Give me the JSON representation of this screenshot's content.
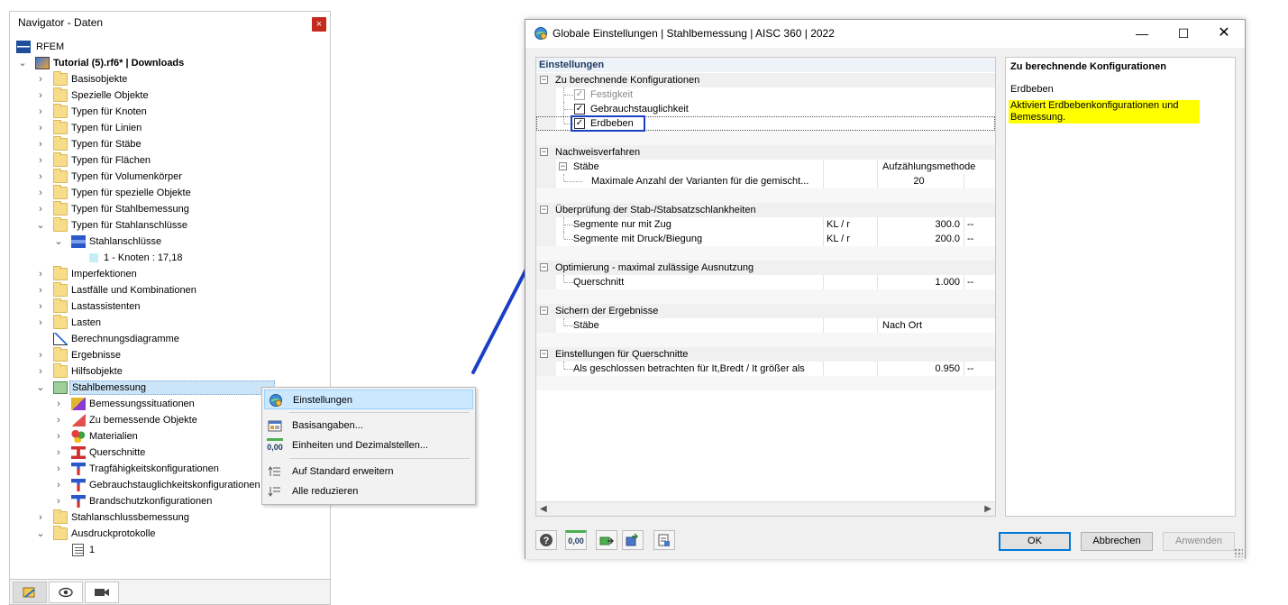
{
  "navigator": {
    "title": "Navigator - Daten",
    "close_glyph": "×",
    "root_label": "RFEM",
    "project_label": "Tutorial (5).rf6* | Downloads",
    "items": {
      "basisobjekte": "Basisobjekte",
      "spezielle_objekte": "Spezielle Objekte",
      "typen_knoten": "Typen für Knoten",
      "typen_linien": "Typen für Linien",
      "typen_staebe": "Typen für Stäbe",
      "typen_flaechen": "Typen für Flächen",
      "typen_volumen": "Typen für Volumenkörper",
      "typen_spezielle": "Typen für spezielle Objekte",
      "typen_stahlbemessung": "Typen für Stahlbemessung",
      "typen_stahlanschluesse": "Typen für Stahlanschlüsse",
      "stahlanschluesse": "Stahlanschlüsse",
      "knoten": "1 - Knoten : 17,18",
      "imperfektionen": "Imperfektionen",
      "lastfaelle": "Lastfälle und Kombinationen",
      "lastassistenten": "Lastassistenten",
      "lasten": "Lasten",
      "berechnungsdiagramme": "Berechnungsdiagramme",
      "ergebnisse": "Ergebnisse",
      "hilfsobjekte": "Hilfsobjekte",
      "stahlbemessung": "Stahlbemessung",
      "bemessungssituationen": "Bemessungssituationen",
      "zu_bemessende": "Zu bemessende Objekte",
      "materialien": "Materialien",
      "querschnitte": "Querschnitte",
      "tragfaehigkeit": "Tragfähigkeitskonfigurationen",
      "gebrauchstauglichkeit": "Gebrauchstauglichkeitskonfigurationen",
      "brandschutz": "Brandschutzkonfigurationen",
      "stahlanschlussbemessung": "Stahlanschlussbemessung",
      "ausdruckprotokolle": "Ausdruckprotokolle",
      "protokoll_1": "1"
    }
  },
  "context_menu": {
    "einstellungen": "Einstellungen",
    "basisangaben": "Basisangaben...",
    "einheiten": "Einheiten und Dezimalstellen...",
    "decimal_icon_text": "0,00",
    "erweitern": "Auf Standard erweitern",
    "reduzieren": "Alle reduzieren"
  },
  "dialog": {
    "title": "Globale Einstellungen | Stahlbemessung | AISC 360 | 2022",
    "grid_header": "Einstellungen",
    "sec_konfig": "Zu berechnende Konfigurationen",
    "festigkeit": "Festigkeit",
    "gebrauchstauglichkeit": "Gebrauchstauglichkeit",
    "erdbeben": "Erdbeben",
    "sec_nachweis": "Nachweisverfahren",
    "staebe": "Stäbe",
    "staebe_value": "Aufzählungsmethode",
    "max_varianten": "Maximale Anzahl der Varianten für die gemischt...",
    "max_varianten_value": "20",
    "sec_schlankheit": "Überprüfung der Stab-/Stabsatzschlankheiten",
    "segmente_zug": "Segmente nur mit Zug",
    "segmente_zug_sym": "KL / r",
    "segmente_zug_value": "300.0",
    "segmente_zug_unit": "--",
    "segmente_druck": "Segmente mit Druck/Biegung",
    "segmente_druck_sym": "KL / r",
    "segmente_druck_value": "200.0",
    "segmente_druck_unit": "--",
    "sec_optimierung": "Optimierung - maximal zulässige Ausnutzung",
    "querschnitt": "Querschnitt",
    "querschnitt_value": "1.000",
    "querschnitt_unit": "--",
    "sec_sichern": "Sichern der Ergebnisse",
    "sichern_staebe": "Stäbe",
    "sichern_value": "Nach Ort",
    "sec_querschnitte": "Einstellungen für Querschnitte",
    "geschlossen": "Als geschlossen betrachten für It,Bredt / It größer als",
    "geschlossen_value": "0.950",
    "geschlossen_unit": "--",
    "info_heading": "Zu berechnende Konfigurationen",
    "info_name": "Erdbeben",
    "info_desc": "Aktiviert Erdbebenkonfigurationen und Bemessung.",
    "decimal_icon_text": "0,00",
    "ok": "OK",
    "cancel": "Abbrechen",
    "apply": "Anwenden"
  },
  "colors": {
    "accent": "#0078d7",
    "arrow": "#1a3fc6",
    "highlight": "#ffff00"
  }
}
